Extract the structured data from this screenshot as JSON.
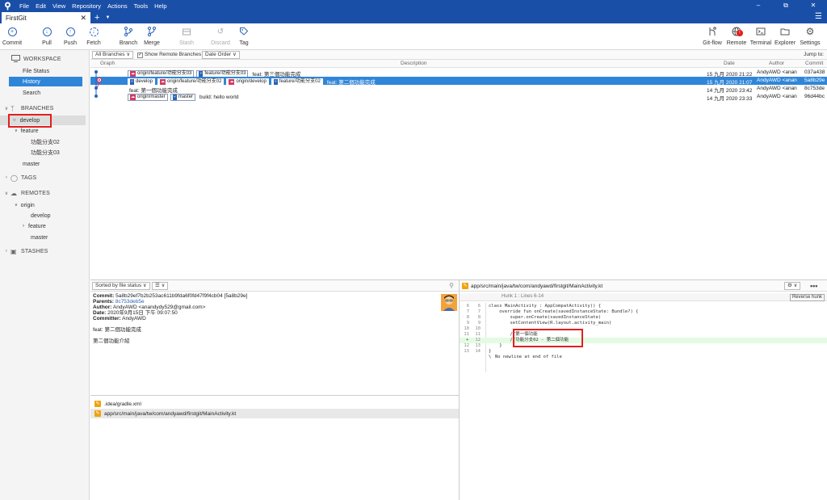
{
  "menu": [
    "File",
    "Edit",
    "View",
    "Repository",
    "Actions",
    "Tools",
    "Help"
  ],
  "tab": {
    "title": "FirstGit"
  },
  "toolbar": {
    "left": [
      "Commit",
      "Pull",
      "Push",
      "Fetch",
      "Branch",
      "Merge",
      "Stash",
      "Discard",
      "Tag"
    ],
    "right": [
      "Git-flow",
      "Remote",
      "Terminal",
      "Explorer",
      "Settings"
    ]
  },
  "sidebar": {
    "workspace": "WORKSPACE",
    "workspace_items": [
      "File Status",
      "History",
      "Search"
    ],
    "branches": "BRANCHES",
    "branch_items": [
      "develop",
      "feature",
      "功能分支02",
      "功能分支03",
      "master"
    ],
    "tags": "TAGS",
    "remotes": "REMOTES",
    "remote_items": [
      "origin",
      "develop",
      "feature",
      "master"
    ],
    "stashes": "STASHES"
  },
  "filters": {
    "branches": "All Branches",
    "show_remote": "Show Remote Branches",
    "order": "Date Order",
    "jump": "Jump to:"
  },
  "columns": {
    "graph": "Graph",
    "description": "Description",
    "date": "Date",
    "author": "Author",
    "commit": "Commit"
  },
  "commits": [
    {
      "refs": [
        {
          "name": "origin/feature/功能分支03",
          "remote": true
        },
        {
          "name": "feature/功能分支03",
          "remote": false
        }
      ],
      "message": "feat: 第三個功能完成",
      "date": "15 九月 2020 21:22",
      "author": "AndyAWD <anan",
      "hash": "037a438"
    },
    {
      "refs": [
        {
          "name": "develop",
          "remote": false
        },
        {
          "name": "origin/feature/功能分支02",
          "remote": true
        },
        {
          "name": "origin/develop",
          "remote": true
        },
        {
          "name": "feature/功能分支02",
          "remote": false
        }
      ],
      "message": "feat: 第二個功能完成",
      "date": "15 九月 2020 21:07",
      "author": "AndyAWD <anan",
      "hash": "5a8b29e"
    },
    {
      "refs": [],
      "message": "feat: 第一個功能完成",
      "date": "14 九月 2020 23:42",
      "author": "AndyAWD <anan",
      "hash": "8c753de"
    },
    {
      "refs": [
        {
          "name": "origin/master",
          "remote": true
        },
        {
          "name": "master",
          "remote": false
        }
      ],
      "message": "build: hello world",
      "date": "14 九月 2020 23:33",
      "author": "AndyAWD <anan",
      "hash": "96d44bc"
    }
  ],
  "commit_detail": {
    "commit_label": "Commit:",
    "commit_value": "5a8b29ef7b2b253ac611b9fda6f0fd47f9f4cb04 [5a8b29e]",
    "parents_label": "Parents:",
    "parents_value": "8c753deb5e",
    "author_label": "Author:",
    "author_value": "AndyAWD <anandydy529@gmail.com>",
    "date_label": "Date:",
    "date_value": "2020年9月15日 下午 09:07:50",
    "committer_label": "Committer:",
    "committer_value": "AndyAWD",
    "subject": "feat: 第二個功能完成",
    "body": "第二個功能介紹"
  },
  "sort": {
    "label": "Sorted by file status"
  },
  "files": [
    ".idea/gradle.xml",
    "app/src/main/java/tw/com/andyawd/firstgit/MainActivity.kt"
  ],
  "diff": {
    "path": "app/src/main/java/tw/com/andyawd/firstgit/MainActivity.kt",
    "hunk": "Hunk 1 : Lines 6-14",
    "reverse": "Reverse hunk",
    "lines": [
      {
        "o": "6",
        "n": "6",
        "s": "",
        "t": "class MainActivity : AppCompatActivity() {"
      },
      {
        "o": "7",
        "n": "7",
        "s": "",
        "t": "    override fun onCreate(savedInstanceState: Bundle?) {"
      },
      {
        "o": "8",
        "n": "8",
        "s": "",
        "t": "        super.onCreate(savedInstanceState)"
      },
      {
        "o": "9",
        "n": "9",
        "s": "",
        "t": "        setContentView(R.layout.activity_main)"
      },
      {
        "o": "10",
        "n": "10",
        "s": "",
        "t": ""
      },
      {
        "o": "11",
        "n": "11",
        "s": "",
        "t": "        //第一個功能"
      },
      {
        "o": "",
        "n": "12",
        "s": "+",
        "t": "        //功能分支02 - 第二個功能"
      },
      {
        "o": "12",
        "n": "13",
        "s": "",
        "t": "    }"
      },
      {
        "o": "13",
        "n": "14",
        "s": "",
        "t": "}"
      },
      {
        "o": "",
        "n": "",
        "s": "\\",
        "t": "No newline at end of file"
      }
    ]
  },
  "colors": {
    "accent": "#1a4fa8",
    "selection": "#2f86d9",
    "highlight": "#e02020"
  }
}
